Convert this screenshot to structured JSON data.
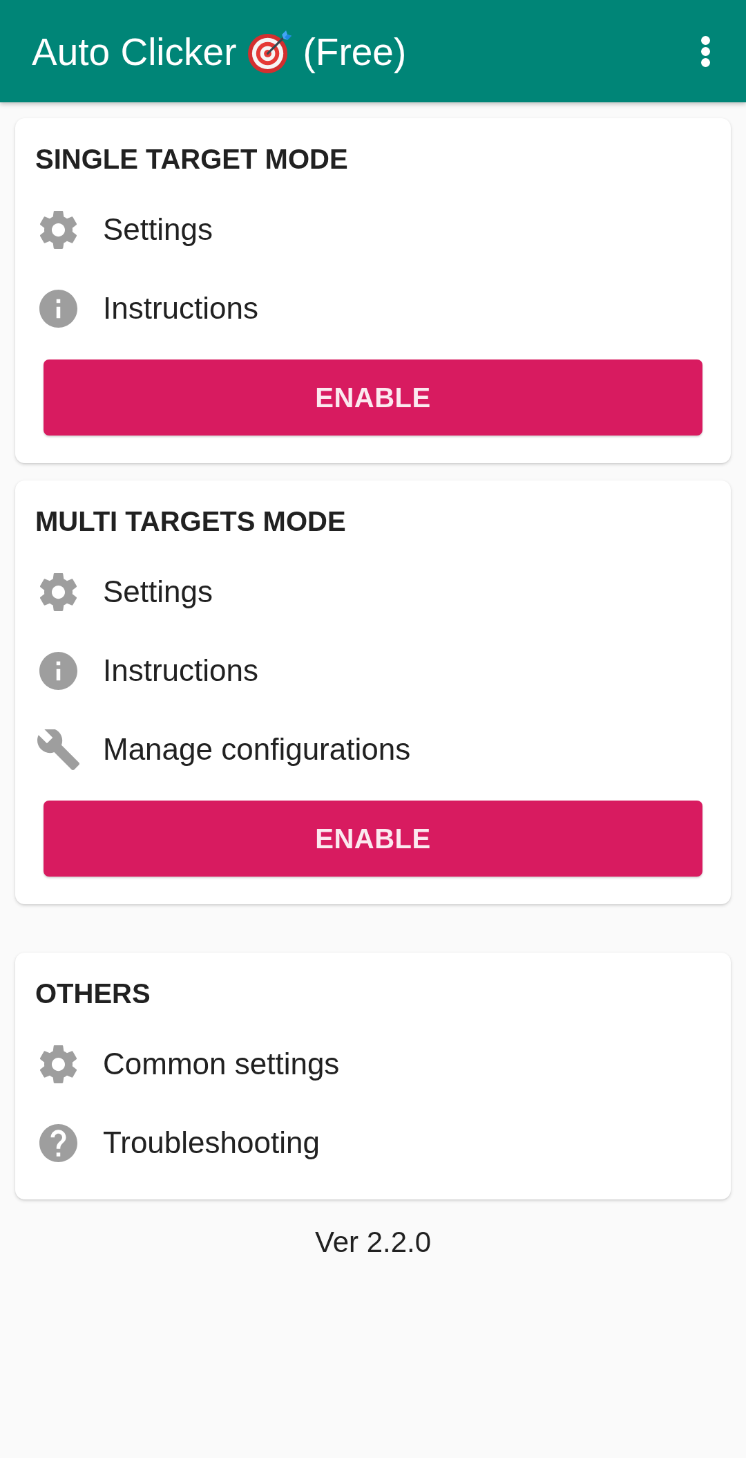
{
  "app_bar": {
    "title": "Auto Clicker",
    "edition": "(Free)"
  },
  "modes": [
    {
      "title": "SINGLE TARGET MODE",
      "items": [
        {
          "kind": "settings",
          "label": "Settings"
        },
        {
          "kind": "info",
          "label": "Instructions"
        }
      ],
      "button": "ENABLE"
    },
    {
      "title": "MULTI TARGETS MODE",
      "items": [
        {
          "kind": "settings",
          "label": "Settings"
        },
        {
          "kind": "info",
          "label": "Instructions"
        },
        {
          "kind": "tools",
          "label": "Manage configurations"
        }
      ],
      "button": "ENABLE"
    }
  ],
  "others": {
    "title": "OTHERS",
    "items": [
      {
        "kind": "settings",
        "label": "Common settings"
      },
      {
        "kind": "help",
        "label": "Troubleshooting"
      }
    ]
  },
  "version": "Ver 2.2.0"
}
